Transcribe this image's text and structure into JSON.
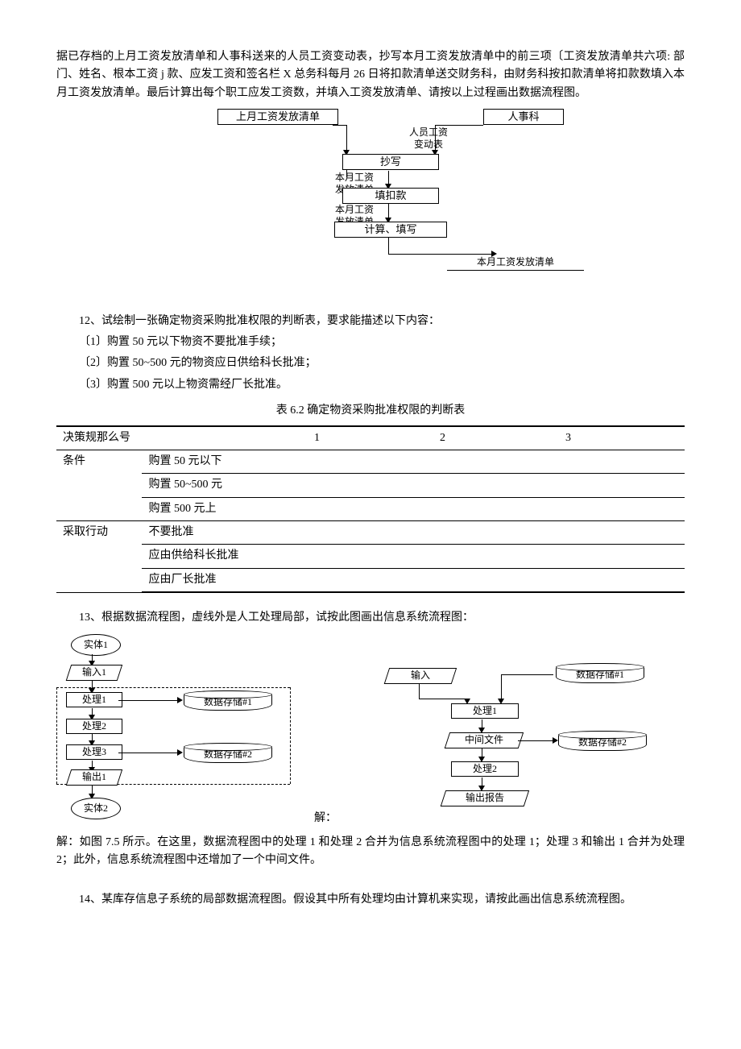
{
  "intro": "据已存档的上月工资发放清单和人事科送来的人员工资变动表，抄写本月工资发放清单中的前三项〔工资发放清单共六项: 部门、姓名、根本工资 j 款、应发工资和签名栏 X 总务科每月 26 日将扣款清单送交财务科，由财务科按扣款清单将扣款数填入本月工资发放清单。最后计算出每个职工应发工资数，并填入工资发放清单、请按以上过程画出数据流程图。",
  "fc1": {
    "top_left": "上月工资发放清单",
    "top_right": "人事科",
    "edge12": "人员工资\n变动表",
    "step1": "抄写",
    "sheet1": "本月工资\n发放清单",
    "step2": "填扣款",
    "sheet2": "本月工资\n发放清单",
    "step3": "计算、填写",
    "out": "本月工资发放清单"
  },
  "q12": "12、试绘制一张确定物资采购批准权限的判断表，要求能描述以下内容：",
  "q12_1": "〔1〕购置 50 元以下物资不要批准手续；",
  "q12_2": "〔2〕购置 50~500 元的物资应日供给科长批准；",
  "q12_3": "〔3〕购置 500 元以上物资需经厂长批准。",
  "table_caption": "表 6.2  确定物资采购批准权限的判断表",
  "table": {
    "header": [
      "决策规那么号",
      "1",
      "2",
      "3"
    ],
    "cond_label": "条件",
    "cond": [
      "购置 50 元以下",
      "购置 50~500 元",
      "购置 500 元上"
    ],
    "act_label": "采取行动",
    "act": [
      "不要批准",
      "应由供给科长批准",
      "应由厂长批准"
    ]
  },
  "q13": "13、根据数据流程图，虚线外是人工处理局部，试按此图画出信息系统流程图：",
  "fc2": {
    "left": {
      "e1": "实体1",
      "in1": "输入1",
      "p1": "处理1",
      "p2": "处理2",
      "p3": "处理3",
      "out1": "输出1",
      "e2": "实体2",
      "d1": "数据存储#1",
      "d2": "数据存储#2"
    },
    "right": {
      "in": "输入",
      "p1": "处理1",
      "mid": "中间文件",
      "p2": "处理2",
      "out": "输出报告",
      "d1": "数据存储#1",
      "d2": "数据存储#2"
    },
    "sep": "解："
  },
  "ans13": "解：如图 7.5 所示。在这里，数据流程图中的处理 1 和处理 2 合并为信息系统流程图中的处理 1；处理 3 和输出 1 合并为处理 2；此外，信息系统流程图中还增加了一个中间文件。",
  "q14": "14、某库存信息子系统的局部数据流程图。假设其中所有处理均由计算机来实现，请按此画出信息系统流程图。"
}
